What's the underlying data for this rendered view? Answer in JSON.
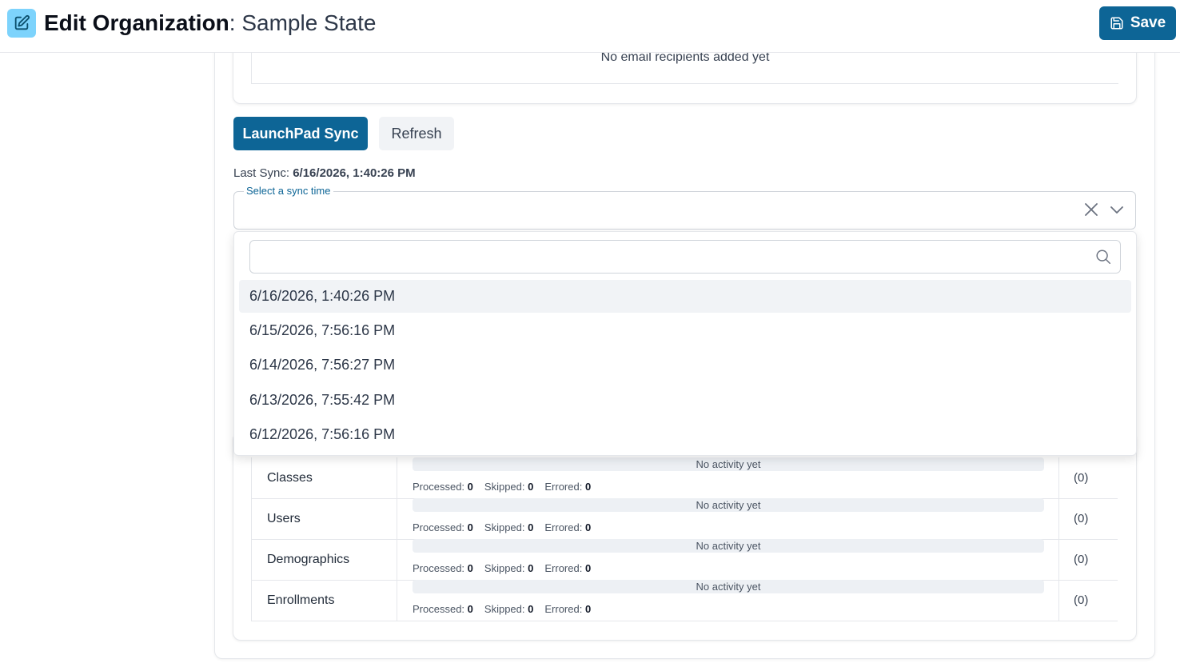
{
  "header": {
    "title_bold": "Edit Organization",
    "title_rest": ": Sample State",
    "save_label": "Save"
  },
  "email": {
    "empty_text": "No email recipients added yet"
  },
  "sync": {
    "launchpad_label": "LaunchPad Sync",
    "refresh_label": "Refresh",
    "last_sync_label": "Last Sync: ",
    "last_sync_value": "6/16/2026, 1:40:26 PM",
    "select_label": "Select a sync time",
    "options": [
      "6/16/2026, 1:40:26 PM",
      "6/15/2026, 7:56:16 PM",
      "6/14/2026, 7:56:27 PM",
      "6/13/2026, 7:55:42 PM",
      "6/12/2026, 7:56:16 PM"
    ]
  },
  "table": {
    "rows": [
      {
        "name": "Classes",
        "bar_text": "No activity yet",
        "processed_label": "Processed:",
        "processed": "0",
        "skipped_label": "Skipped:",
        "skipped": "0",
        "errored_label": "Errored:",
        "errored": "0",
        "count": "(0)"
      },
      {
        "name": "Users",
        "bar_text": "No activity yet",
        "processed_label": "Processed:",
        "processed": "0",
        "skipped_label": "Skipped:",
        "skipped": "0",
        "errored_label": "Errored:",
        "errored": "0",
        "count": "(0)"
      },
      {
        "name": "Demographics",
        "bar_text": "No activity yet",
        "processed_label": "Processed:",
        "processed": "0",
        "skipped_label": "Skipped:",
        "skipped": "0",
        "errored_label": "Errored:",
        "errored": "0",
        "count": "(0)"
      },
      {
        "name": "Enrollments",
        "bar_text": "No activity yet",
        "processed_label": "Processed:",
        "processed": "0",
        "skipped_label": "Skipped:",
        "skipped": "0",
        "errored_label": "Errored:",
        "errored": "0",
        "count": "(0)"
      }
    ]
  },
  "colors": {
    "primary": "#0d6596",
    "icon_bg": "#7dd3fc"
  },
  "icons": {
    "edit": "edit-icon",
    "save": "save-icon",
    "clear": "close-icon",
    "chevron": "chevron-down-icon",
    "search": "search-icon"
  }
}
